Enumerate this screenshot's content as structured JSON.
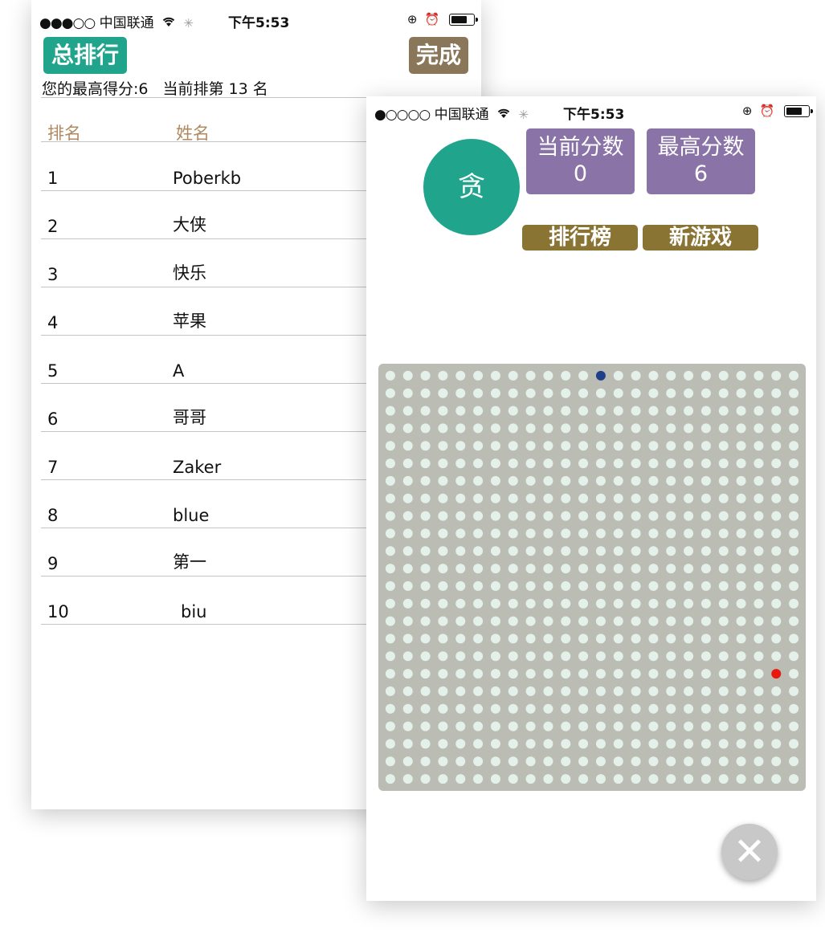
{
  "leaderboard_screen": {
    "status_bar": {
      "signal": "●●●○○",
      "carrier": "中国联通",
      "time": "下午5:53"
    },
    "title_button": "总排行",
    "done_button": "完成",
    "best_score_text": "您的最高得分:6",
    "current_rank_text": "当前排第 13 名",
    "columns": [
      "排名",
      "姓名"
    ],
    "rows": [
      {
        "rank": "1",
        "name": "Poberkb"
      },
      {
        "rank": "2",
        "name": "大侠"
      },
      {
        "rank": "3",
        "name": "快乐"
      },
      {
        "rank": "4",
        "name": "苹果"
      },
      {
        "rank": "5",
        "name": "A"
      },
      {
        "rank": "6",
        "name": "哥哥"
      },
      {
        "rank": "7",
        "name": "Zaker"
      },
      {
        "rank": "8",
        "name": "blue"
      },
      {
        "rank": "9",
        "name": "第一"
      },
      {
        "rank": "10",
        "name": "biu"
      }
    ]
  },
  "game_screen": {
    "status_bar": {
      "signal": "●○○○○",
      "carrier": "中国联通",
      "time": "下午5:53"
    },
    "logo_char": "贪",
    "current_score": {
      "label": "当前分数",
      "value": "0"
    },
    "best_score": {
      "label": "最高分数",
      "value": "6"
    },
    "leaderboard_button": "排行榜",
    "new_game_button": "新游戏",
    "board": {
      "cols": 24,
      "rows": 24,
      "snake_cell": {
        "col": 12,
        "row": 0
      },
      "food_cell": {
        "col": 22,
        "row": 17
      },
      "empty_color": "#e4f1ea",
      "snake_color": "#1f3f8a",
      "food_color": "#e8180c"
    },
    "close_button": "✕"
  }
}
